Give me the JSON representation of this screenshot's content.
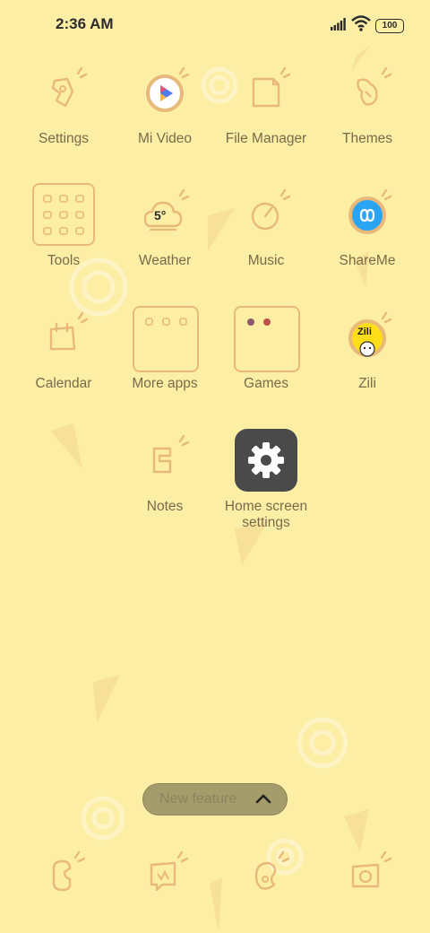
{
  "status_bar": {
    "time": "2:36 AM",
    "battery": "100",
    "signal_icon": "signal-icon",
    "wifi_icon": "wifi-icon"
  },
  "apps": {
    "settings": "Settings",
    "mi_video": "Mi Video",
    "file_manager": "File Manager",
    "themes": "Themes",
    "tools": "Tools",
    "weather": "Weather",
    "weather_temp": "5°",
    "music": "Music",
    "shareme": "ShareMe",
    "calendar": "Calendar",
    "more_apps": "More apps",
    "games": "Games",
    "zili": "Zili",
    "zili_logo_text": "Zili",
    "notes": "Notes",
    "home_settings_line1": "Home screen",
    "home_settings_line2": "settings"
  },
  "new_feature": {
    "label": "New feature"
  },
  "colors": {
    "background": "#fdeea6",
    "icon_stroke": "#e8b97a",
    "label": "#7a6a4a",
    "settings_tile": "#4a4a4a"
  }
}
